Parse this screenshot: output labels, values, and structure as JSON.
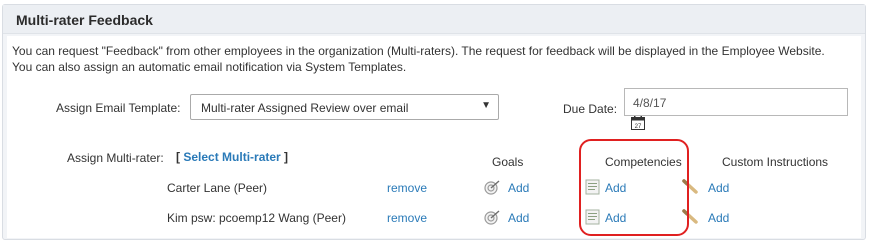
{
  "panel": {
    "title": "Multi-rater Feedback",
    "description": "You can request \"Feedback\" from other employees in the organization (Multi-raters). The request for feedback will be displayed in the Employee Website. You can also assign an automatic email notification via System Templates."
  },
  "email_template": {
    "label": "Assign Email Template:",
    "selected": "Multi-rater Assigned Review over email"
  },
  "due_date": {
    "label": "Due Date:",
    "value": "4/8/17",
    "calendar_day": "27"
  },
  "multirater": {
    "label": "Assign Multi-rater:",
    "bracket_open": "[",
    "link": "Select Multi-rater",
    "bracket_close": "]"
  },
  "columns": {
    "goals": "Goals",
    "competencies": "Competencies",
    "custom_instructions": "Custom Instructions"
  },
  "rows": [
    {
      "name": "Carter Lane (Peer)",
      "remove": "remove",
      "goals_add": "Add",
      "competencies_add": "Add",
      "custom_add": "Add"
    },
    {
      "name": "Kim psw: pcoemp12 Wang (Peer)",
      "remove": "remove",
      "goals_add": "Add",
      "competencies_add": "Add",
      "custom_add": "Add"
    }
  ],
  "icons": {
    "goals": "target-icon",
    "competencies": "document-icon",
    "custom_instructions": "pencil-icon",
    "due_date": "calendar-icon",
    "select": "caret-down-icon"
  },
  "colors": {
    "link": "#2a7ab8",
    "highlight": "#e02020"
  }
}
